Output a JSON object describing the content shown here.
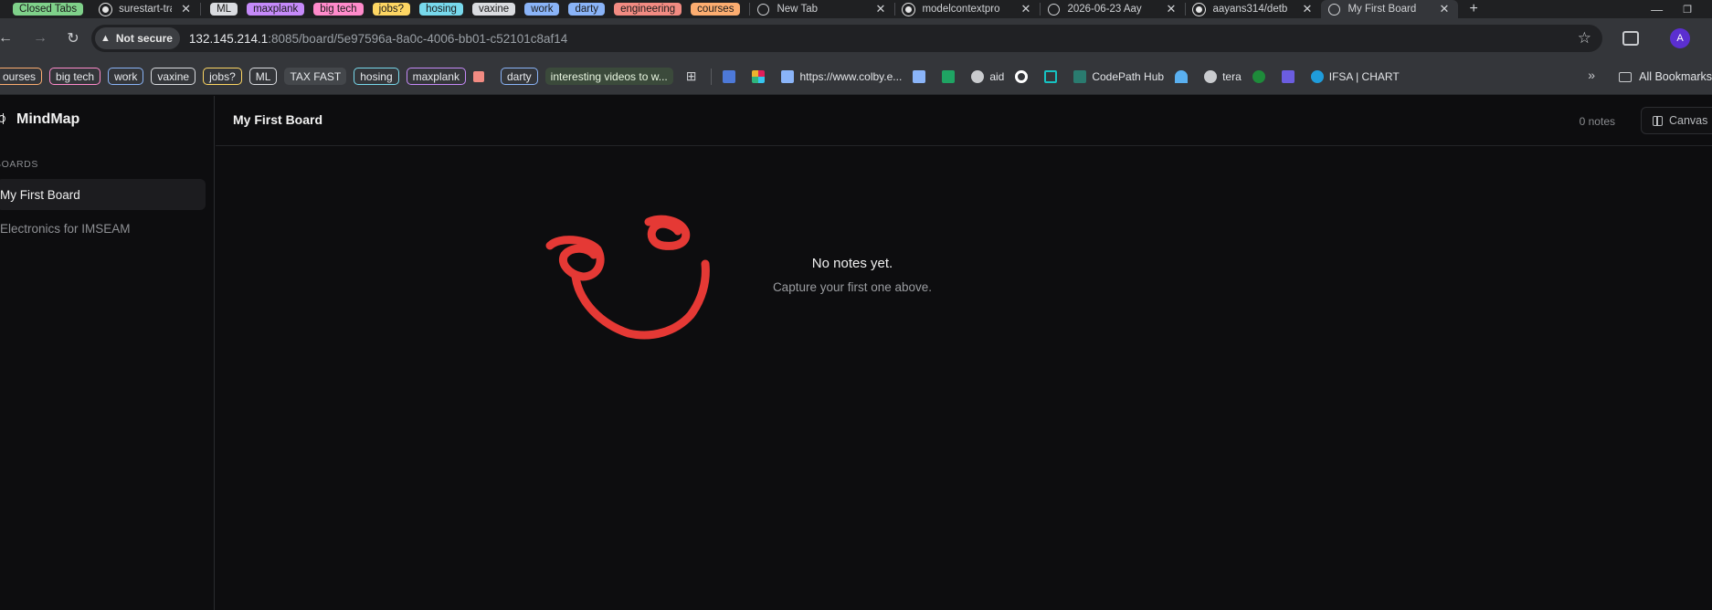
{
  "browser": {
    "tab_groups": [
      {
        "label": "Closed Tabs",
        "color": "#7fd18a"
      }
    ],
    "tabs_left": [
      {
        "title": "surestart-trailbla",
        "icon": "github-icon"
      }
    ],
    "group_chips": [
      {
        "label": "ML",
        "color": "#dadce0"
      },
      {
        "label": "maxplank",
        "color": "#c58af9"
      },
      {
        "label": "big tech",
        "color": "#ff8bcb"
      },
      {
        "label": "jobs?",
        "color": "#fdd663"
      },
      {
        "label": "hosing",
        "color": "#78d9ec"
      },
      {
        "label": "vaxine",
        "color": "#dadce0"
      },
      {
        "label": "work",
        "color": "#8ab4f8"
      },
      {
        "label": "darty",
        "color": "#8ab4f8"
      },
      {
        "label": "engineering",
        "color": "#f28b82"
      },
      {
        "label": "courses",
        "color": "#fcad70"
      }
    ],
    "tabs": [
      {
        "title": "New Tab",
        "icon": "globe-icon"
      },
      {
        "title": "modelcontextpro",
        "icon": "github-icon"
      },
      {
        "title": "2026-06-23 Aay",
        "icon": "globe-icon"
      },
      {
        "title": "aayans314/detb",
        "icon": "github-icon"
      },
      {
        "title": "My First Board",
        "icon": "globe-icon",
        "active": true
      }
    ],
    "new_tab_label": "+",
    "address": {
      "security_label": "Not secure",
      "host": "132.145.214.1",
      "path": ":8085/board/5e97596a-8a0c-4006-bb01-c52101c8af14"
    },
    "profile_initial": "A",
    "bookmark_groups": [
      {
        "label": "ourses",
        "color": "#fcad70"
      },
      {
        "label": "big tech",
        "color": "#ff8bcb"
      },
      {
        "label": "work",
        "color": "#8ab4f8"
      },
      {
        "label": "vaxine",
        "color": "#dadce0"
      },
      {
        "label": "jobs?",
        "color": "#fdd663"
      },
      {
        "label": "ML",
        "color": "#dadce0"
      }
    ],
    "bookmark_groups_2": [
      {
        "label": "hosing",
        "color": "#78d9ec"
      },
      {
        "label": "maxplank",
        "color": "#c58af9"
      }
    ],
    "bookmark_tax": "TAX FAST",
    "bookmark_darty": "darty",
    "bookmark_videos": "interesting videos to w...",
    "bookmarks": [
      {
        "label": "https://www.colby.e...",
        "icon": "colby-icon"
      },
      {
        "label": "aid",
        "icon": "globe-icon"
      },
      {
        "label": "CodePath Hub",
        "icon": "codepath-icon"
      },
      {
        "label": "tera",
        "icon": "globe-icon"
      },
      {
        "label": "IFSA | CHART",
        "icon": "salesforce-icon"
      }
    ],
    "all_bookmarks": "All Bookmarks"
  },
  "sidebar": {
    "brand": "MindMap",
    "section": "BOARDS",
    "boards": [
      {
        "label": "My First Board",
        "active": true
      },
      {
        "label": "Electronics for IMSEAM",
        "active": false
      }
    ]
  },
  "main": {
    "title": "My First Board",
    "note_count": "0 notes",
    "view_button": "Canvas",
    "empty_title": "No notes yet.",
    "empty_subtitle": "Capture your first one above.",
    "drawing_color": "#e53935"
  }
}
